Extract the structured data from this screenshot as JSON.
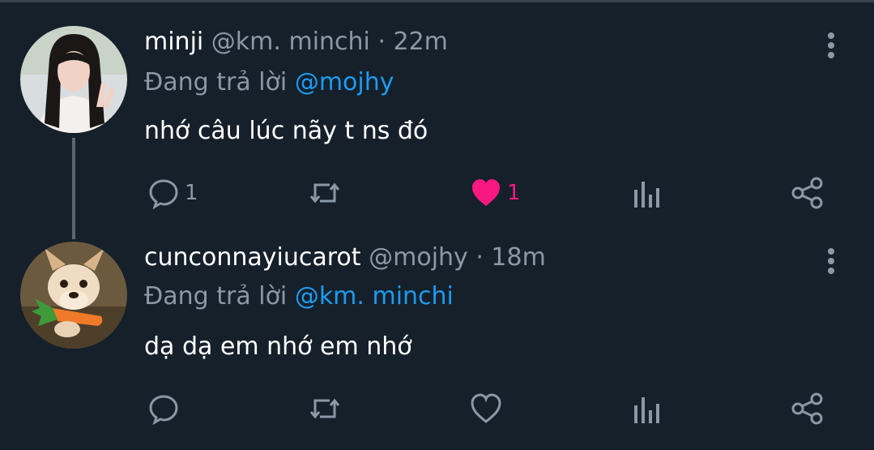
{
  "tweets": [
    {
      "name": "minji",
      "handle": "@km. minchi",
      "time": "· 22m",
      "reply_prefix": "Đang trả lời",
      "reply_to": "@mojhy",
      "text": "nhớ câu lúc nãy t ns đó",
      "replies": "1",
      "likes": "1",
      "liked": true
    },
    {
      "name": "cunconnayiucarot",
      "handle": "@mojhy",
      "time": "· 18m",
      "reply_prefix": "Đang trả lời",
      "reply_to": "@km. minchi",
      "text": "dạ dạ em nhớ em nhớ",
      "replies": "",
      "likes": "",
      "liked": false
    }
  ],
  "icons": {
    "reply": "comment-icon",
    "retweet": "retweet-icon",
    "like": "heart-icon",
    "views": "views-icon",
    "share": "share-icon",
    "more": "more-vertical-icon"
  },
  "colors": {
    "background": "#15202b",
    "secondary_text": "#8b98a5",
    "mention": "#1d9bf0",
    "like": "#f91880"
  }
}
